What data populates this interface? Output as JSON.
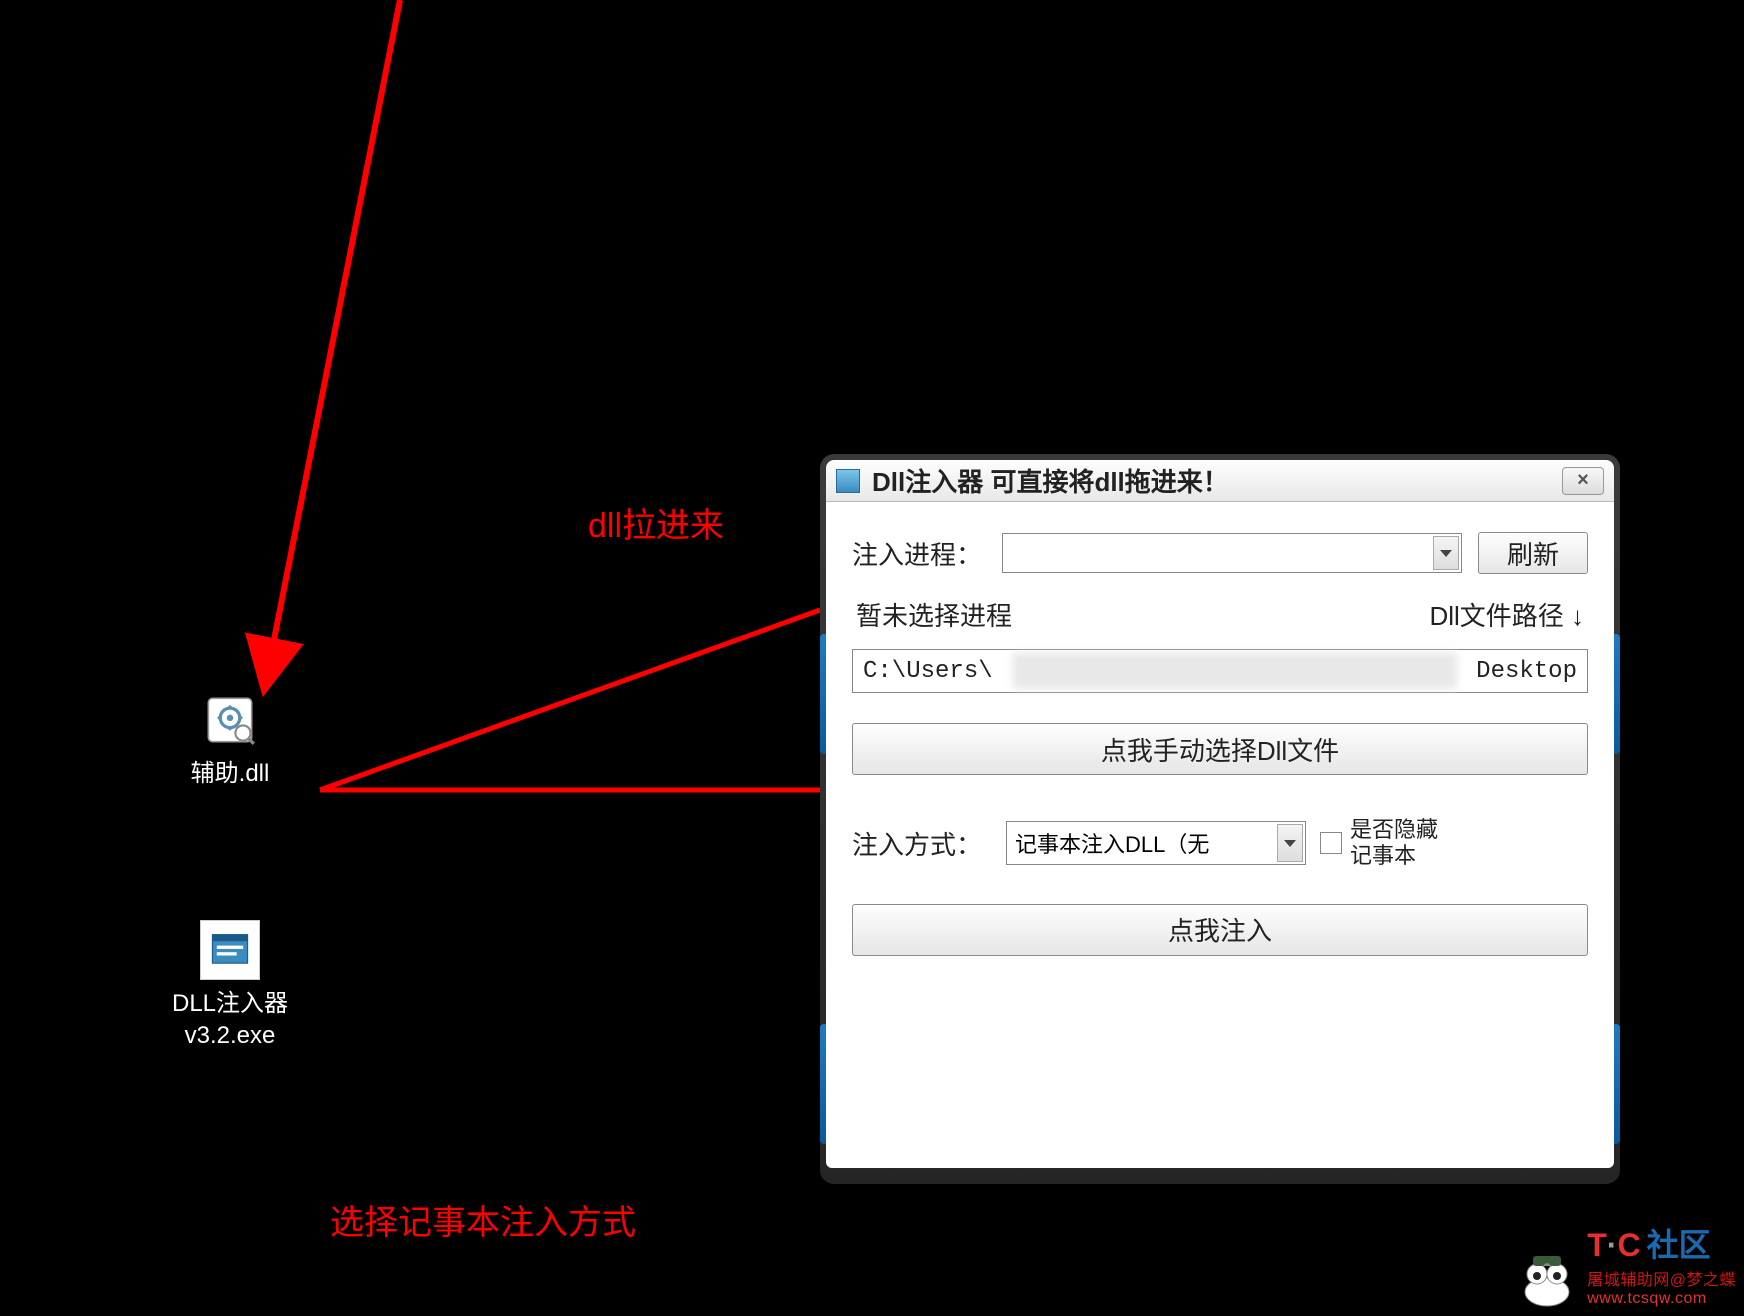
{
  "desktop": {
    "icons": {
      "dll": {
        "label": "辅助.dll"
      },
      "exe": {
        "label": "DLL注入器\nv3.2.exe"
      }
    }
  },
  "annotations": {
    "drag_hint": "dll拉进来",
    "method_hint": "选择记事本注入方式"
  },
  "window": {
    "title": "Dll注入器    可直接将dll拖进来！",
    "close": "×",
    "process_label": "注入进程：",
    "process_value": "",
    "refresh_btn": "刷新",
    "status_text": "暂未选择进程",
    "path_label": "Dll文件路径 ↓",
    "path_start": "C:\\Users\\",
    "path_end": "Desktop",
    "select_dll_btn": "点我手动选择Dll文件",
    "method_label": "注入方式：",
    "method_value": "记事本注入DLL（无",
    "hide_checkbox_label": "是否隐藏\n记事本",
    "inject_btn": "点我注入"
  },
  "watermark": {
    "brand": "T·C 社区",
    "url": "屠城辅助网@梦之蝶",
    "url2": "www.tcsqw.com"
  }
}
